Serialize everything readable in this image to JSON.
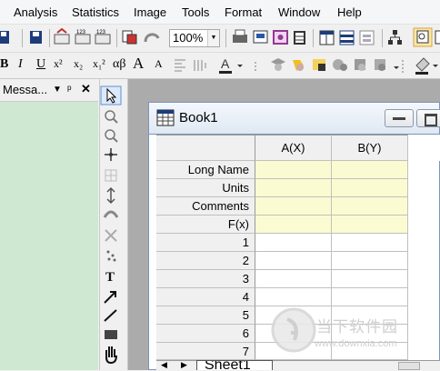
{
  "menu": [
    "Analysis",
    "Statistics",
    "Image",
    "Tools",
    "Format",
    "Window",
    "Help"
  ],
  "toolbar": {
    "zoom": "100%"
  },
  "format_toolbar": {
    "labels": [
      "B",
      "I",
      "U",
      "x²",
      "x₂",
      "x₁²",
      "αβ",
      "A",
      "A"
    ]
  },
  "messages_panel": {
    "title": "Messa...",
    "pin": "▼ ᵖ ✕"
  },
  "book": {
    "title": "Book1",
    "columns": [
      "A(X)",
      "B(Y)"
    ],
    "header_rows": [
      "Long Name",
      "Units",
      "Comments",
      "F(x)"
    ],
    "data_rows": [
      "1",
      "2",
      "3",
      "4",
      "5",
      "6",
      "7"
    ],
    "sheet_tab": "Sheet1"
  },
  "watermark": {
    "text_cn": "当下软件园",
    "url": "www.downxia.com"
  },
  "colors": {
    "panel_green": "#cfe8d1",
    "header_yellow": "#fbfbd2",
    "workspace_gray": "#ababab"
  }
}
